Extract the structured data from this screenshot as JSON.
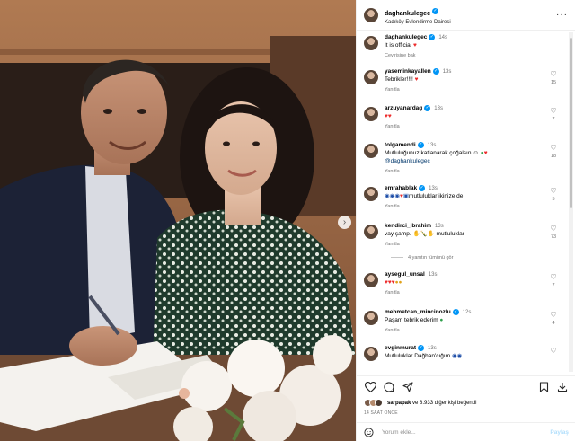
{
  "post": {
    "author": "daghankulegec",
    "location": "Kadıköy Evlendirme Dairesi",
    "caption": "It is official",
    "caption_time": "14s",
    "translate_label": "Çevirisine bak"
  },
  "comments": [
    {
      "user": "yaseminkayallen",
      "time": "13s",
      "text": "Tebrikler!!!!",
      "reply": "Yanıtla",
      "likes": "15",
      "verified": true
    },
    {
      "user": "arzuyanardag",
      "time": "13s",
      "text": "",
      "reply": "Yanıtla",
      "likes": "7",
      "verified": true
    },
    {
      "user": "tolgamendi",
      "time": "13s",
      "text": "Mutluluğunuz katlanarak çoğalsın",
      "mention": "@daghankulegec",
      "reply": "Yanıtla",
      "likes": "18",
      "verified": true
    },
    {
      "user": "emrahablak",
      "time": "13s",
      "text": "mutluluklar ikinize de",
      "reply": "Yanıtla",
      "likes": "5",
      "verified": true
    },
    {
      "user": "kendirci_ibrahim",
      "time": "13s",
      "text": "vay şamp.",
      "text2": "mutluluklar",
      "reply": "Yanıtla",
      "likes": "73",
      "verified": false,
      "view_replies": "4 yanıtın tümünü gör"
    },
    {
      "user": "aysegul_unsal",
      "time": "13s",
      "text": "",
      "reply": "Yanıtla",
      "likes": "7",
      "verified": false
    },
    {
      "user": "mehmetcan_mincinozlu",
      "time": "12s",
      "text": "Paşam tebrik ederim",
      "reply": "Yanıtla",
      "likes": "4",
      "verified": true
    },
    {
      "user": "evginmurat",
      "time": "13s",
      "text": "Mutluluklar Dağhan'cığım",
      "reply": "",
      "likes": "",
      "verified": true
    }
  ],
  "likes": {
    "user": "sarpapak",
    "rest": "ve 8.933 diğer kişi beğendi"
  },
  "post_time": "14 SAAT ÖNCE",
  "comment_input": {
    "placeholder": "Yorum ekle...",
    "post_label": "Paylaş"
  },
  "icons": {
    "next": "chevron-right-icon",
    "like": "heart-icon",
    "comment": "comment-icon",
    "share": "share-icon",
    "save": "bookmark-icon",
    "download": "download-icon",
    "emoji": "smile-icon",
    "more": "more-dots-icon"
  },
  "colors": {
    "verified": "#0095f6",
    "heart_red": "#ed2b2b",
    "meta_gray": "#737373",
    "post_button": "#b2dffc"
  }
}
